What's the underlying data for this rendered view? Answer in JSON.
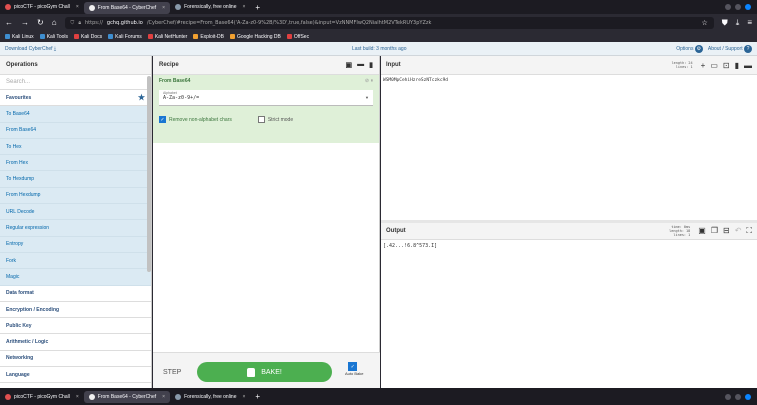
{
  "browser": {
    "tabs": [
      {
        "label": "picoCTF - picoGym Chall",
        "active": false,
        "fav_color": "#e05050"
      },
      {
        "label": "From Base64 - CyberChef",
        "active": true,
        "fav_color": "#f0f0f0"
      },
      {
        "label": "Forensically, free online",
        "active": false,
        "fav_color": "#8899aa"
      }
    ],
    "url_prefix": "https://",
    "url_host": "gchq.github.io",
    "url_path": "/CyberChef/#recipe=From_Base64('A-Za-z0-9%2B/%3D',true,false)&input=VzNNMFIwQ2NialhtM2VTekRUY3pYZzk",
    "bookmarks": [
      {
        "label": "Kali Linux",
        "color": "#3e8ed0"
      },
      {
        "label": "Kali Tools",
        "color": "#3e8ed0"
      },
      {
        "label": "Kali Docs",
        "color": "#e04040"
      },
      {
        "label": "Kali Forums",
        "color": "#3e8ed0"
      },
      {
        "label": "Kali NetHunter",
        "color": "#e04040"
      },
      {
        "label": "Exploit-DB",
        "color": "#f0a030"
      },
      {
        "label": "Google Hacking DB",
        "color": "#f0a030"
      },
      {
        "label": "OffSec",
        "color": "#e04040"
      }
    ]
  },
  "cyberchef": {
    "download_label": "Download CyberChef",
    "last_build": "Last build: 3 months ago",
    "options_label": "Options",
    "about_label": "About / Support",
    "operations": {
      "title": "Operations",
      "search_placeholder": "Search...",
      "favourites": "Favourites",
      "favourite_items": [
        "To Base64",
        "From Base64",
        "To Hex",
        "From Hex",
        "To Hexdump",
        "From Hexdump",
        "URL Decode",
        "Regular expression",
        "Entropy",
        "Fork",
        "Magic"
      ],
      "categories": [
        "Data format",
        "Encryption / Encoding",
        "Public Key",
        "Arithmetic / Logic",
        "Networking",
        "Language"
      ]
    },
    "recipe": {
      "title": "Recipe",
      "op_title": "From Base64",
      "alphabet_label": "Alphabet",
      "alphabet_value": "A-Za-z0-9+/=",
      "remove_nonalpha_label": "Remove non-alphabet chars",
      "remove_nonalpha_checked": true,
      "strict_label": "Strict mode",
      "strict_checked": false
    },
    "bake": {
      "step_label": "STEP",
      "bake_label": "BAKE!",
      "autobake_label": "Auto Bake",
      "autobake_checked": true
    },
    "input": {
      "title": "Input",
      "stats": [
        "length: 24",
        "lines: 1"
      ],
      "text": "WSM0MpCehiHzreSzNTczkc9d"
    },
    "output": {
      "title": "Output",
      "stats": [
        "time: 0ms",
        "length: 18",
        "lines: 1"
      ],
      "text": "[.42...!6.8^573.I]"
    }
  }
}
